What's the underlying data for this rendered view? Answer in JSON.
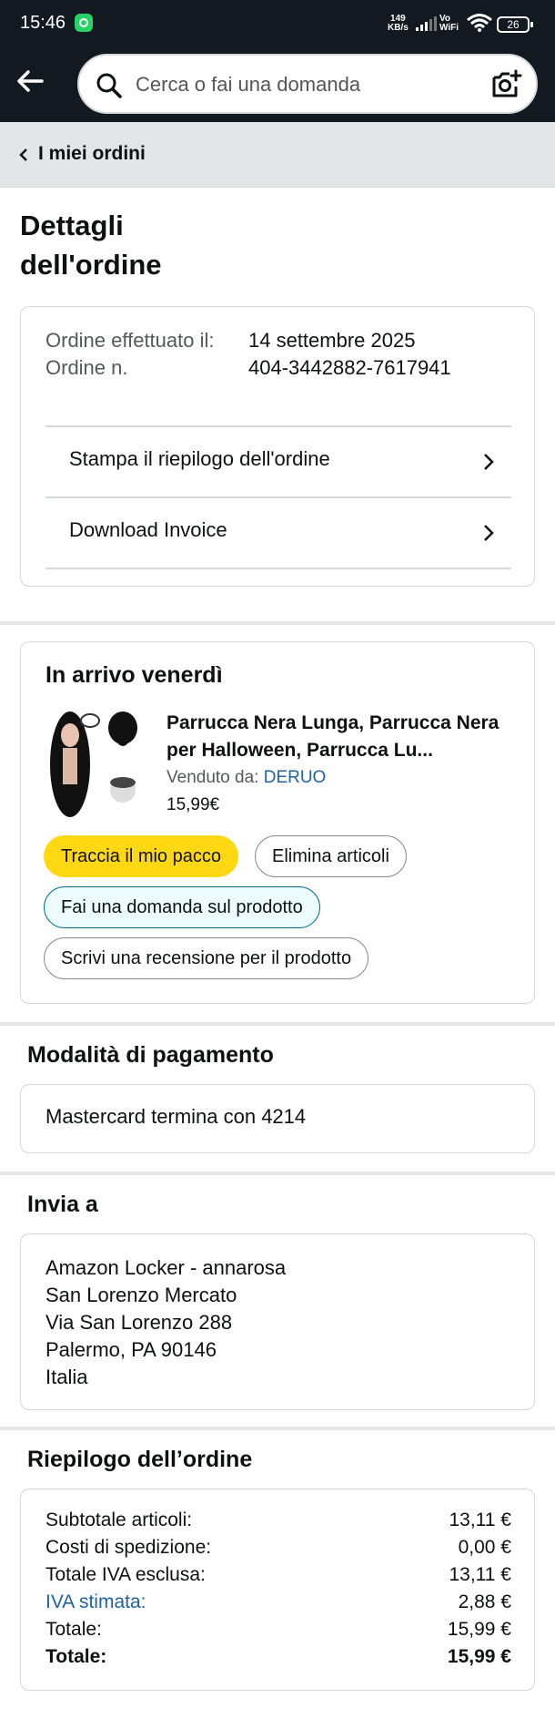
{
  "status_bar": {
    "time": "15:46",
    "speed_line1": "149",
    "speed_line2": "KB/s",
    "vowifi_line1": "Vo",
    "vowifi_line2": "WiFi",
    "battery": "26"
  },
  "search": {
    "placeholder": "Cerca o fai una domanda"
  },
  "breadcrumb": {
    "label": "I miei ordini"
  },
  "page_title": "Dettagli dell'ordine",
  "order_info": {
    "placed_label": "Ordine effettuato il:",
    "number_label": "Ordine n.",
    "placed_date": "14 settembre 2025",
    "order_number": "404-3442882-7617941",
    "links": {
      "print": "Stampa il riepilogo dell'ordine",
      "invoice": "Download Invoice"
    }
  },
  "shipment": {
    "heading": "In arrivo venerdì",
    "product_title": "Parrucca Nera Lunga, Parrucca Nera per Halloween, Parrucca Lu...",
    "sold_by_label": "Venduto da:",
    "seller": "DERUO",
    "price": "15,99€",
    "buttons": {
      "track": "Traccia il mio pacco",
      "remove": "Elimina articoli",
      "ask": "Fai una domanda sul prodotto",
      "review": "Scrivi una recensione per il prodotto"
    }
  },
  "payment": {
    "heading": "Modalità di pagamento",
    "method": "Mastercard  termina con 4214"
  },
  "shipping": {
    "heading": "Invia a",
    "address_lines": [
      "Amazon Locker - annarosa",
      "San Lorenzo Mercato",
      "Via San Lorenzo 288",
      "Palermo, PA 90146",
      "Italia"
    ]
  },
  "summary": {
    "heading": "Riepilogo dell’ordine",
    "rows": [
      {
        "label": "Subtotale articoli:",
        "value": "13,11 €"
      },
      {
        "label": "Costi di spedizione:",
        "value": "0,00 €"
      },
      {
        "label": "Totale IVA esclusa:",
        "value": "13,11 €"
      },
      {
        "label": "IVA stimata:",
        "value": "2,88 €"
      },
      {
        "label": "Totale:",
        "value": "15,99 €"
      },
      {
        "label": "Totale:",
        "value": "15,99 €"
      }
    ]
  },
  "colors": {
    "header_bg": "#131921",
    "accent_yellow": "#ffd814",
    "link_blue": "#2162a1",
    "breadcrumb_bg": "#e3e6e6"
  }
}
